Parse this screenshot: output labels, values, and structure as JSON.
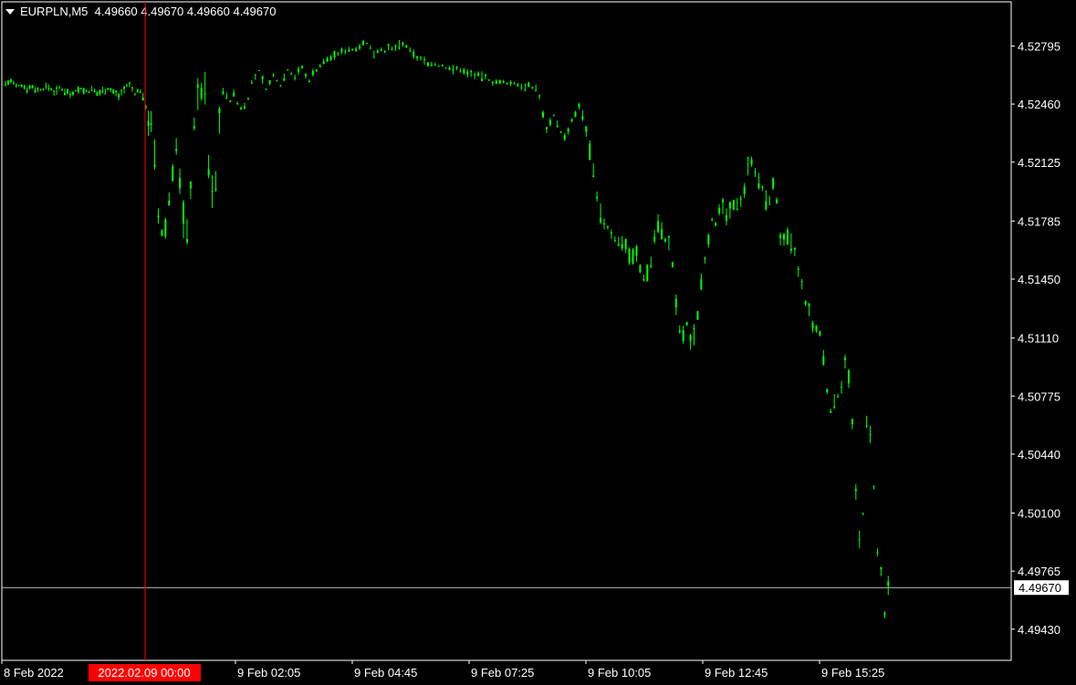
{
  "header": {
    "symbol": "EURPLN,M5",
    "ohlc": "4.49660 4.49670 4.49660 4.49670"
  },
  "colors": {
    "background": "#000000",
    "candle": "#00ff00",
    "current_price_line": "#c0c0c0",
    "crosshair": "#ff0000",
    "axis": "#ffffff"
  },
  "chart_data": {
    "type": "line",
    "symbol": "EURPLN",
    "timeframe": "M5",
    "current_price": "4.49670",
    "crosshair_time_label": "2022.02.09 00:00",
    "ylim": [
      4.4925,
      4.5305
    ],
    "y_ticks": [
      "4.52795",
      "4.52460",
      "4.52125",
      "4.51785",
      "4.51450",
      "4.51110",
      "4.50775",
      "4.50440",
      "4.50100",
      "4.49765",
      "4.49430"
    ],
    "x_ticks": [
      "8 Feb 2022",
      "9 Feb 02:05",
      "9 Feb 04:45",
      "9 Feb 07:25",
      "9 Feb 10:05",
      "9 Feb 12:45",
      "9 Feb 15:25"
    ],
    "bar_ranges": [
      [
        0,
        4.5258
      ],
      [
        6,
        4.5259
      ],
      [
        12,
        4.5256
      ],
      [
        18,
        4.5257
      ],
      [
        24,
        4.5255
      ],
      [
        30,
        4.5256
      ],
      [
        36,
        4.5254
      ],
      [
        42,
        4.5255
      ],
      [
        48,
        4.5256
      ],
      [
        54,
        4.5253
      ],
      [
        60,
        4.5255
      ],
      [
        66,
        4.5254
      ],
      [
        72,
        4.5252
      ],
      [
        78,
        4.5254
      ],
      [
        84,
        4.5255
      ],
      [
        90,
        4.5253
      ],
      [
        96,
        4.5254
      ],
      [
        102,
        4.5252
      ],
      [
        108,
        4.5254
      ],
      [
        114,
        4.5255
      ],
      [
        120,
        4.5253
      ],
      [
        126,
        4.5251
      ],
      [
        132,
        4.5255
      ],
      [
        138,
        4.5257
      ],
      [
        144,
        4.5252
      ],
      [
        150,
        4.5254
      ],
      [
        156,
        4.5245
      ],
      [
        162,
        4.5232
      ],
      [
        166,
        4.5215
      ],
      [
        170,
        4.518
      ],
      [
        174,
        4.517
      ],
      [
        178,
        4.5175
      ],
      [
        182,
        4.519
      ],
      [
        186,
        4.521
      ],
      [
        190,
        4.522
      ],
      [
        194,
        4.52
      ],
      [
        198,
        4.518
      ],
      [
        202,
        4.517
      ],
      [
        206,
        4.52
      ],
      [
        210,
        4.5235
      ],
      [
        214,
        4.525
      ],
      [
        218,
        4.5255
      ],
      [
        222,
        4.5253
      ],
      [
        226,
        4.521
      ],
      [
        230,
        4.5195
      ],
      [
        234,
        4.52
      ],
      [
        238,
        4.524
      ],
      [
        242,
        4.5254
      ],
      [
        246,
        4.525
      ],
      [
        250,
        4.5248
      ],
      [
        254,
        4.5252
      ],
      [
        258,
        4.5246
      ],
      [
        262,
        4.5244
      ],
      [
        266,
        4.5245
      ],
      [
        270,
        4.525
      ],
      [
        274,
        4.5258
      ],
      [
        278,
        4.5262
      ],
      [
        282,
        4.5265
      ],
      [
        286,
        4.526
      ],
      [
        290,
        4.5255
      ],
      [
        294,
        4.5258
      ],
      [
        298,
        4.5262
      ],
      [
        302,
        4.526
      ],
      [
        306,
        4.5257
      ],
      [
        310,
        4.5262
      ],
      [
        314,
        4.5266
      ],
      [
        318,
        4.5264
      ],
      [
        322,
        4.5262
      ],
      [
        326,
        4.5265
      ],
      [
        330,
        4.5267
      ],
      [
        334,
        4.5262
      ],
      [
        338,
        4.526
      ],
      [
        342,
        4.5264
      ],
      [
        346,
        4.5266
      ],
      [
        350,
        4.5268
      ],
      [
        354,
        4.527
      ],
      [
        358,
        4.5272
      ],
      [
        362,
        4.5273
      ],
      [
        366,
        4.5274
      ],
      [
        370,
        4.5275
      ],
      [
        374,
        4.5276
      ],
      [
        378,
        4.5277
      ],
      [
        382,
        4.5278
      ],
      [
        386,
        4.5277
      ],
      [
        390,
        4.5279
      ],
      [
        394,
        4.528
      ],
      [
        398,
        4.5281
      ],
      [
        402,
        4.5281
      ],
      [
        406,
        4.5278
      ],
      [
        410,
        4.5276
      ],
      [
        414,
        4.5277
      ],
      [
        418,
        4.5278
      ],
      [
        422,
        4.5277
      ],
      [
        426,
        4.5278
      ],
      [
        430,
        4.5277
      ],
      [
        434,
        4.5279
      ],
      [
        438,
        4.528
      ],
      [
        442,
        4.528
      ],
      [
        446,
        4.5279
      ],
      [
        450,
        4.5276
      ],
      [
        454,
        4.5275
      ],
      [
        458,
        4.5273
      ],
      [
        462,
        4.5272
      ],
      [
        466,
        4.5271
      ],
      [
        470,
        4.527
      ],
      [
        474,
        4.5269
      ],
      [
        478,
        4.5269
      ],
      [
        482,
        4.5268
      ],
      [
        486,
        4.5268
      ],
      [
        490,
        4.5267
      ],
      [
        494,
        4.5267
      ],
      [
        498,
        4.5266
      ],
      [
        502,
        4.5266
      ],
      [
        506,
        4.5266
      ],
      [
        510,
        4.5265
      ],
      [
        514,
        4.5264
      ],
      [
        518,
        4.5264
      ],
      [
        522,
        4.5263
      ],
      [
        526,
        4.5262
      ],
      [
        530,
        4.5262
      ],
      [
        534,
        4.5261
      ],
      [
        538,
        4.526
      ],
      [
        542,
        4.5259
      ],
      [
        546,
        4.5259
      ],
      [
        550,
        4.5258
      ],
      [
        554,
        4.5258
      ],
      [
        558,
        4.5258
      ],
      [
        562,
        4.5258
      ],
      [
        566,
        4.5258
      ],
      [
        570,
        4.5257
      ],
      [
        574,
        4.5257
      ],
      [
        578,
        4.5256
      ],
      [
        582,
        4.5256
      ],
      [
        586,
        4.5255
      ],
      [
        590,
        4.5256
      ],
      [
        594,
        4.525
      ],
      [
        598,
        4.524
      ],
      [
        602,
        4.5232
      ],
      [
        606,
        4.5236
      ],
      [
        610,
        4.524
      ],
      [
        614,
        4.5234
      ],
      [
        618,
        4.523
      ],
      [
        622,
        4.5227
      ],
      [
        626,
        4.523
      ],
      [
        630,
        4.5236
      ],
      [
        634,
        4.524
      ],
      [
        638,
        4.5244
      ],
      [
        642,
        4.5238
      ],
      [
        646,
        4.523
      ],
      [
        650,
        4.522
      ],
      [
        654,
        4.5205
      ],
      [
        658,
        4.519
      ],
      [
        662,
        4.5182
      ],
      [
        666,
        4.5178
      ],
      [
        670,
        4.5174
      ],
      [
        674,
        4.5172
      ],
      [
        678,
        4.5168
      ],
      [
        682,
        4.5165
      ],
      [
        686,
        4.5168
      ],
      [
        690,
        4.5165
      ],
      [
        694,
        4.516
      ],
      [
        698,
        4.5158
      ],
      [
        702,
        4.516
      ],
      [
        706,
        4.515
      ],
      [
        710,
        4.5146
      ],
      [
        714,
        4.515
      ],
      [
        718,
        4.5155
      ],
      [
        722,
        4.517
      ],
      [
        726,
        4.5178
      ],
      [
        730,
        4.5172
      ],
      [
        734,
        4.5168
      ],
      [
        738,
        4.5165
      ],
      [
        742,
        4.5152
      ],
      [
        746,
        4.513
      ],
      [
        750,
        4.5115
      ],
      [
        754,
        4.5112
      ],
      [
        758,
        4.5118
      ],
      [
        762,
        4.511
      ],
      [
        766,
        4.5113
      ],
      [
        770,
        4.5125
      ],
      [
        774,
        4.5145
      ],
      [
        778,
        4.5158
      ],
      [
        782,
        4.517
      ],
      [
        786,
        4.518
      ],
      [
        790,
        4.5178
      ],
      [
        794,
        4.5182
      ],
      [
        798,
        4.5185
      ],
      [
        802,
        4.5182
      ],
      [
        806,
        4.5183
      ],
      [
        810,
        4.5185
      ],
      [
        814,
        4.519
      ],
      [
        818,
        4.5192
      ],
      [
        822,
        4.5198
      ],
      [
        826,
        4.521
      ],
      [
        830,
        4.5215
      ],
      [
        834,
        4.5208
      ],
      [
        838,
        4.52
      ],
      [
        842,
        4.5196
      ],
      [
        846,
        4.519
      ],
      [
        850,
        4.5192
      ],
      [
        854,
        4.5198
      ],
      [
        858,
        4.519
      ],
      [
        862,
        4.517
      ],
      [
        866,
        4.5165
      ],
      [
        870,
        4.5168
      ],
      [
        874,
        4.5165
      ],
      [
        878,
        4.516
      ],
      [
        882,
        4.5148
      ],
      [
        886,
        4.514
      ],
      [
        890,
        4.5132
      ],
      [
        894,
        4.5125
      ],
      [
        898,
        4.5118
      ],
      [
        902,
        4.5115
      ],
      [
        906,
        4.5112
      ],
      [
        910,
        4.51
      ],
      [
        914,
        4.508
      ],
      [
        918,
        4.507
      ],
      [
        922,
        4.5072
      ],
      [
        926,
        4.5078
      ],
      [
        930,
        4.5085
      ],
      [
        934,
        4.51
      ],
      [
        938,
        4.5088
      ],
      [
        942,
        4.506
      ],
      [
        946,
        4.502
      ],
      [
        950,
        4.4995
      ],
      [
        954,
        4.501
      ],
      [
        958,
        4.506
      ],
      [
        962,
        4.5055
      ],
      [
        966,
        4.5025
      ],
      [
        970,
        4.4985
      ],
      [
        974,
        4.4975
      ],
      [
        978,
        4.495
      ],
      [
        982,
        4.4967
      ],
      [
        986,
        4.4967
      ]
    ]
  }
}
